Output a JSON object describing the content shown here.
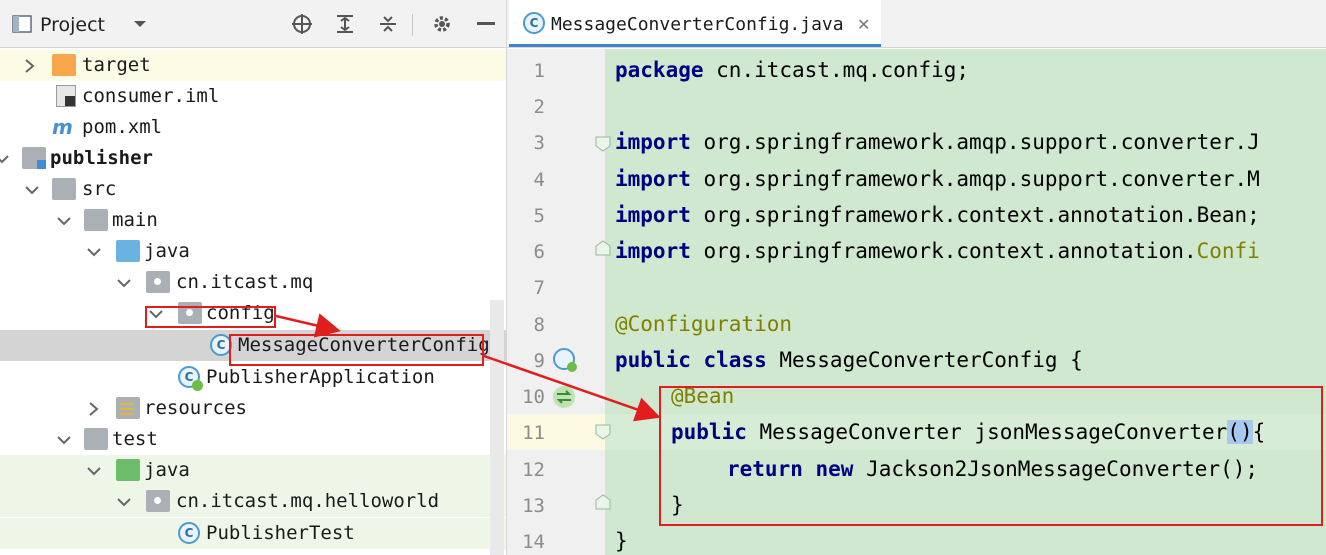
{
  "project_panel": {
    "title": "Project",
    "tree": [
      {
        "label": "target",
        "level": 1,
        "icon": "folder-orange-icon"
      },
      {
        "label": "consumer.iml",
        "level": 1,
        "icon": "iml-file-icon"
      },
      {
        "label": "pom.xml",
        "level": 1,
        "icon": "maven-icon"
      },
      {
        "label": "publisher",
        "level": 0,
        "icon": "module-icon"
      },
      {
        "label": "src",
        "level": 1,
        "icon": "folder-icon"
      },
      {
        "label": "main",
        "level": 2,
        "icon": "folder-icon"
      },
      {
        "label": "java",
        "level": 3,
        "icon": "source-folder-icon"
      },
      {
        "label": "cn.itcast.mq",
        "level": 4,
        "icon": "package-icon"
      },
      {
        "label": "config",
        "level": 5,
        "icon": "package-icon"
      },
      {
        "label": "MessageConverterConfig",
        "level": 6,
        "icon": "class-icon"
      },
      {
        "label": "PublisherApplication",
        "level": 5,
        "icon": "spring-boot-class-icon"
      },
      {
        "label": "resources",
        "level": 3,
        "icon": "resources-folder-icon"
      },
      {
        "label": "test",
        "level": 2,
        "icon": "folder-icon"
      },
      {
        "label": "java",
        "level": 3,
        "icon": "test-folder-icon"
      },
      {
        "label": "cn.itcast.mq.helloworld",
        "level": 4,
        "icon": "package-icon"
      },
      {
        "label": "PublisherTest",
        "level": 5,
        "icon": "class-icon"
      }
    ]
  },
  "editor": {
    "tab_label": "MessageConverterConfig.java",
    "line_numbers": [
      "1",
      "2",
      "3",
      "4",
      "5",
      "6",
      "7",
      "8",
      "9",
      "10",
      "11",
      "12",
      "13",
      "14"
    ],
    "code": {
      "l1_kw": "package",
      "l1_rest": " cn.itcast.mq.config;",
      "l3_kw": "import",
      "l3_rest": " org.springframework.amqp.support.converter.J",
      "l4_kw": "import",
      "l4_rest": " org.springframework.amqp.support.converter.M",
      "l5_kw": "import",
      "l5_rest": " org.springframework.context.annotation.Bean;",
      "l6_kw": "import",
      "l6_rest": " org.springframework.context.annotation.",
      "l6_cfg": "Confi",
      "l8_ann": "@Configuration",
      "l9_kw": "public class",
      "l9_rest": " MessageConverterConfig {",
      "l10_ann": "@Bean",
      "l11_kw": "public",
      "l11_rest": " MessageConverter jsonMessageConverter",
      "l11_paren": "()",
      "l11_brace": "{",
      "l12_kw": "return new",
      "l12_rest": " Jackson2JsonMessageConverter();",
      "l13": "}",
      "l14": "}"
    }
  },
  "colors": {
    "keyword": "#000080",
    "annotation": "#808000",
    "highlight_red": "#e01e1e",
    "code_background": "#cfe8cf",
    "current_line": "#fcfae0"
  }
}
